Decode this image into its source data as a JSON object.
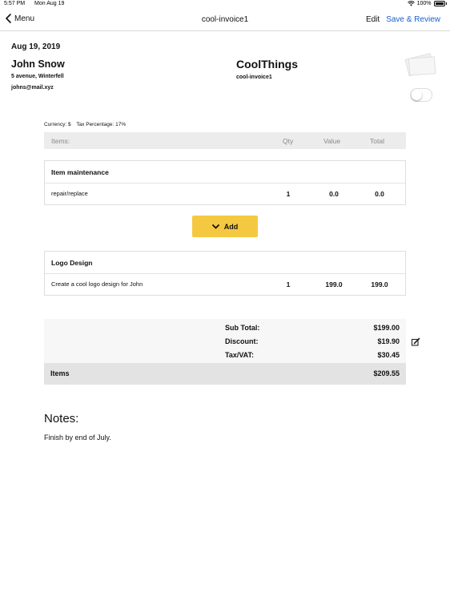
{
  "status_bar": {
    "time": "5:57 PM",
    "date": "Mon Aug 19",
    "battery": "100%"
  },
  "nav": {
    "back_label": "Menu",
    "title": "cool-invoice1",
    "edit_label": "Edit",
    "save_label": "Save & Review"
  },
  "invoice": {
    "date": "Aug 19, 2019",
    "client": {
      "name": "John Snow",
      "address": "5 avenue, Winterfell",
      "email": "johns@mail.xyz"
    },
    "company": {
      "name": "CoolThings",
      "invoice_id": "cool-invoice1"
    },
    "currency": "Currency: $",
    "tax_percentage": "Tax Percentage: 17%"
  },
  "table": {
    "headers": {
      "items": "Items:",
      "qty": "Qty",
      "value": "Value",
      "total": "Total"
    },
    "items": [
      {
        "title": "Item maintenance",
        "description": "repair/replace",
        "qty": "1",
        "value": "0.0",
        "total": "0.0"
      },
      {
        "title": "Logo Design",
        "description": "Create a cool logo design for John",
        "qty": "1",
        "value": "199.0",
        "total": "199.0"
      }
    ]
  },
  "add_button": {
    "label": "Add"
  },
  "summary": {
    "subtotal_label": "Sub Total:",
    "subtotal_value": "$199.00",
    "discount_label": "Discount:",
    "discount_value": "$19.90",
    "tax_label": "Tax/VAT:",
    "tax_value": "$30.45",
    "grand_label": "Items",
    "grand_value": "$209.55"
  },
  "notes": {
    "heading": "Notes:",
    "text": "Finish by end of July."
  },
  "colors": {
    "accent_blue": "#1a5fd0",
    "add_yellow": "#f5c842",
    "header_gray": "#ececec",
    "total_gray": "#e3e3e3"
  }
}
